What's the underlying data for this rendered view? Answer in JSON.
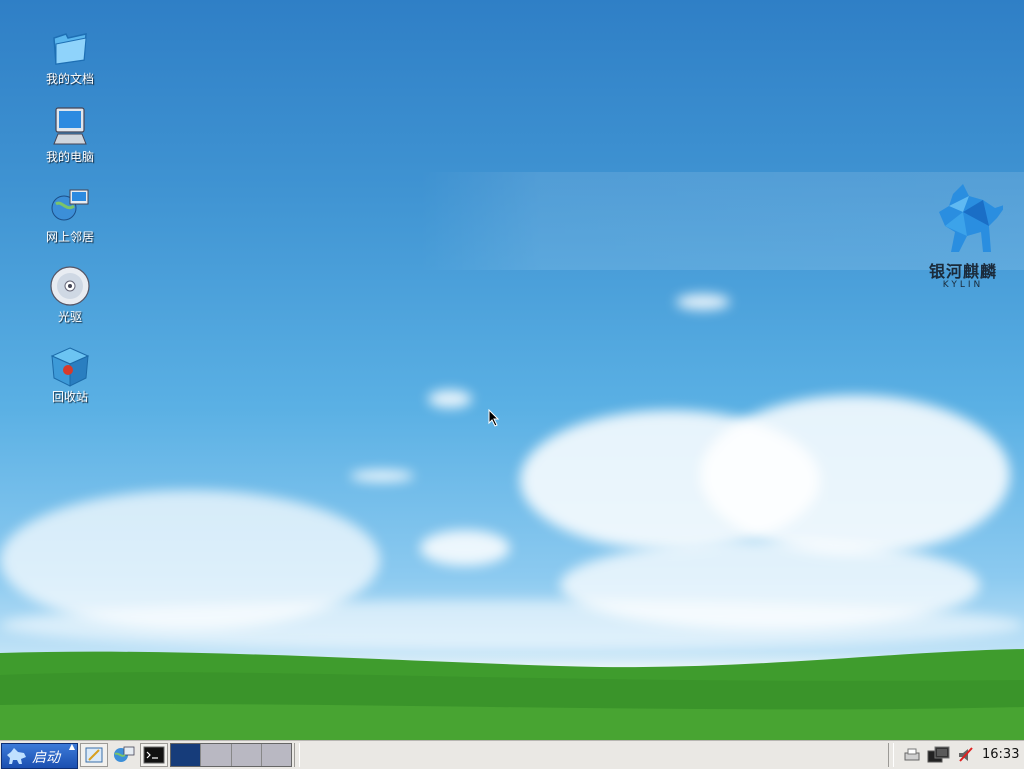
{
  "desktop": {
    "icons": [
      {
        "label": "我的文档",
        "icon": "folder-icon"
      },
      {
        "label": "我的电脑",
        "icon": "computer-icon"
      },
      {
        "label": "网上邻居",
        "icon": "network-icon"
      },
      {
        "label": "光驱",
        "icon": "cdrom-icon"
      },
      {
        "label": "回收站",
        "icon": "trash-icon"
      }
    ]
  },
  "logo": {
    "name_cn": "银河麒麟",
    "name_en": "KYLIN"
  },
  "taskbar": {
    "start_label": "启动",
    "clock": "16:33",
    "pager_active_workspace": 1,
    "pager_workspace_count": 4
  },
  "colors": {
    "sky": "#3f93d2",
    "grass": "#3e9a2c",
    "start": "#1b4fb0",
    "taskbar": "#eae8e4"
  }
}
